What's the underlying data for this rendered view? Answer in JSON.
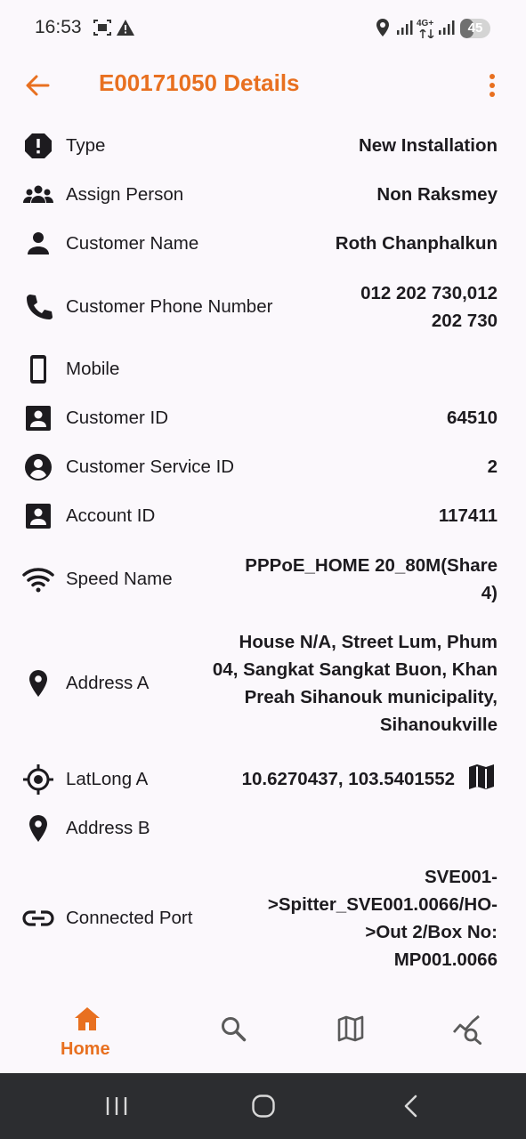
{
  "status_bar": {
    "time": "16:53",
    "network": "4G+",
    "battery": "45",
    "battery_level": 0.45,
    "icons": [
      "screenshot-icon",
      "warning-icon",
      "location-icon",
      "signal-icon",
      "signal-icon"
    ]
  },
  "app_bar": {
    "title": "E00171050 Details",
    "accent_color": "#e87020"
  },
  "details": [
    {
      "icon": "alert-octagon-icon",
      "label": "Type",
      "value": "New Installation"
    },
    {
      "icon": "people-icon",
      "label": "Assign Person",
      "value": "Non Raksmey"
    },
    {
      "icon": "person-icon",
      "label": "Customer Name",
      "value": "Roth Chanphalkun"
    },
    {
      "icon": "phone-icon",
      "label": "Customer Phone Number",
      "value_lines": [
        "012 202 730,012",
        "202 730"
      ]
    },
    {
      "icon": "smartphone-icon",
      "label": "Mobile",
      "value": ""
    },
    {
      "icon": "account-box-icon",
      "label": "Customer ID",
      "value": "64510"
    },
    {
      "icon": "account-circle-icon",
      "label": "Customer Service ID",
      "value": "2"
    },
    {
      "icon": "account-box-icon",
      "label": "Account ID",
      "value": "117411"
    },
    {
      "icon": "wifi-icon",
      "label": "Speed Name",
      "value_lines": [
        "PPPoE_HOME 20_80M(Share",
        "4)"
      ]
    },
    {
      "icon": "location-pin-icon",
      "label": "Address A",
      "value_lines": [
        "House N/A, Street Lum, Phum",
        "04, Sangkat Sangkat Buon, Khan",
        "Preah Sihanouk municipality,",
        "Sihanoukville"
      ]
    },
    {
      "icon": "gps-target-icon",
      "label": "LatLong A",
      "value": "10.6270437, 103.5401552",
      "action_icon": "map-icon"
    },
    {
      "icon": "location-pin-icon",
      "label": "Address B",
      "value": ""
    },
    {
      "icon": "link-icon",
      "label": "Connected Port",
      "value_lines": [
        "SVE001-",
        ">Spitter_SVE001.0066/HO-",
        ">Out 2/Box No:",
        "MP001.0066"
      ]
    }
  ],
  "bottom_nav": {
    "home_label": "Home",
    "items": [
      "home-icon",
      "search-icon",
      "map-icon",
      "analytics-search-icon"
    ],
    "active": "home"
  }
}
